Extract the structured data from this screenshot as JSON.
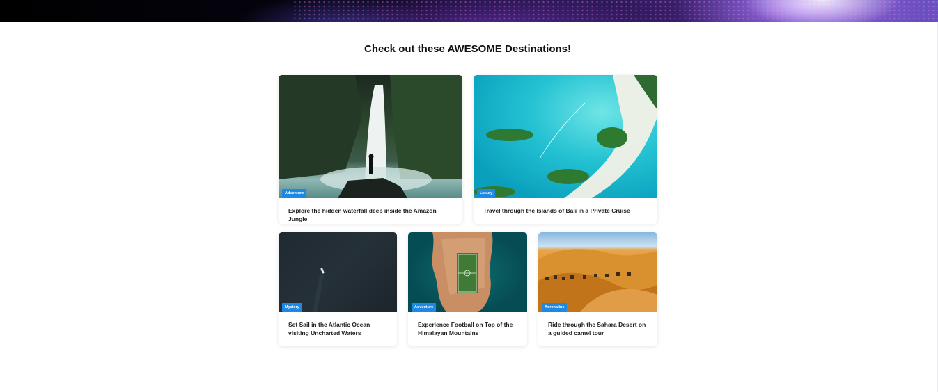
{
  "section": {
    "title": "Check out these AWESOME Destinations!"
  },
  "cards": [
    {
      "badge": "Adventure",
      "title": "Explore the hidden waterfall deep inside the Amazon Jungle",
      "image": "waterfall-photo"
    },
    {
      "badge": "Luxury",
      "title": "Travel through the Islands of Bali in a Private Cruise",
      "image": "islands-photo"
    },
    {
      "badge": "Mystery",
      "title": "Set Sail in the Atlantic Ocean visiting Uncharted Waters",
      "image": "ocean-photo"
    },
    {
      "badge": "Adventure",
      "title": "Experience Football on Top of the Himalayan Mountains",
      "image": "football-island-photo"
    },
    {
      "badge": "Adrenaline",
      "title": "Ride through the Sahara Desert on a guided camel tour",
      "image": "desert-photo"
    }
  ],
  "colors": {
    "badge": "#1e88e5",
    "title": "#111111",
    "card_text": "#222222"
  }
}
